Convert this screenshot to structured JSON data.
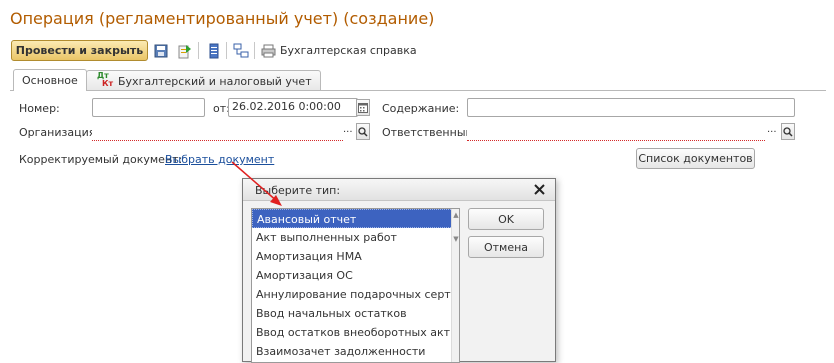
{
  "window": {
    "title": "Операция (регламентированный учет) (создание)"
  },
  "toolbar": {
    "post_close_label": "Провести и закрыть",
    "report_label": "Бухгалтерская справка",
    "icons": [
      "save-icon",
      "export-icon",
      "list-icon",
      "structure-icon",
      "print-icon"
    ]
  },
  "tabs": [
    {
      "label": "Основное",
      "active": true
    },
    {
      "label": "Бухгалтерский и налоговый учет",
      "active": false,
      "icon_text": {
        "top": "Дт",
        "bottom": "Кт"
      }
    }
  ],
  "form": {
    "number_label": "Номер:",
    "number_value": "",
    "date_label": "от:",
    "date_value": "26.02.2016  0:00:00",
    "content_label": "Содержание:",
    "content_value": "",
    "org_label": "Организация:",
    "org_value": "",
    "responsible_label": "Ответственный:",
    "responsible_value": "",
    "ellipsis": "...",
    "corrected_doc_label": "Корректируемый документ:",
    "select_doc_link": "Выбрать документ",
    "doc_list_button": "Список документов"
  },
  "dialog": {
    "title": "Выберите тип:",
    "ok_label": "OK",
    "cancel_label": "Отмена",
    "items": [
      "Авансовый отчет",
      "Акт выполненных работ",
      "Амортизация НМА",
      "Амортизация ОС",
      "Аннулирование подарочных серти...",
      "Ввод начальных остатков",
      "Ввод остатков внеоборотных акти...",
      "Взаимозачет задолженности"
    ],
    "selected_index": 0
  },
  "colors": {
    "title": "#b25c00",
    "selected_item": "#3d63c0",
    "link": "#1b4f9c",
    "arrow": "#e02020"
  }
}
